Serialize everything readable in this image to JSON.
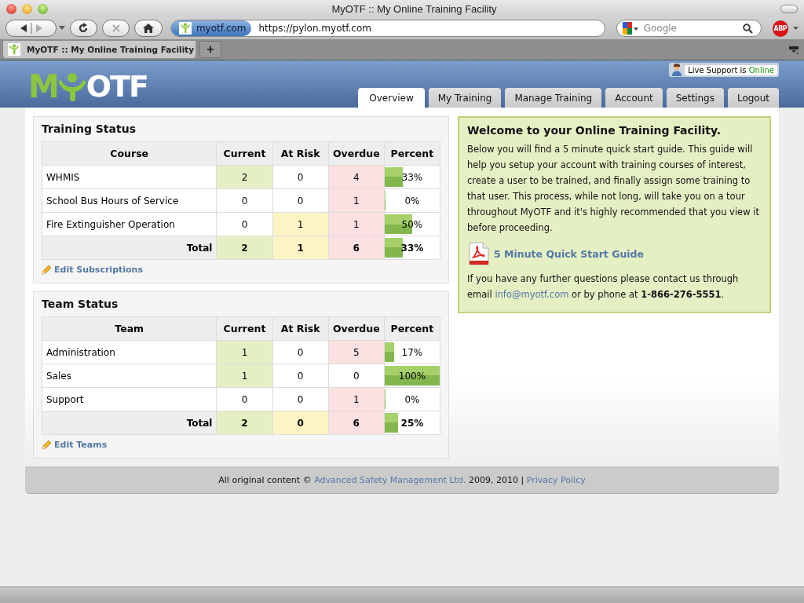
{
  "window": {
    "title": "MyOTF :: My Online Training Facility"
  },
  "toolbar": {
    "site": "myotf.com",
    "url": "https://pylon.myotf.com",
    "search_placeholder": "Google",
    "adblock": "ABP"
  },
  "tabs": [
    {
      "label": "MyOTF :: My Online Training Facility",
      "selected": true
    }
  ],
  "new_tab": "+",
  "header": {
    "logo_left": "M",
    "logo_right": "OTF",
    "live_support": {
      "text": "Live Support is",
      "status": "Online",
      "online": true
    },
    "nav": [
      {
        "label": "Overview",
        "selected": true
      },
      {
        "label": "My Training",
        "selected": false
      },
      {
        "label": "Manage Training",
        "selected": false
      },
      {
        "label": "Account",
        "selected": false
      },
      {
        "label": "Settings",
        "selected": false
      },
      {
        "label": "Logout",
        "selected": false
      }
    ]
  },
  "panels": [
    {
      "title": "Training Status",
      "columns": [
        "Course",
        "Current",
        "At Risk",
        "Overdue",
        "Percent"
      ],
      "rows": [
        {
          "kind": "item",
          "name": "WHMIS",
          "current": {
            "value": "2",
            "highlight": true
          },
          "at_risk": {
            "value": "0",
            "highlight": false
          },
          "overdue": {
            "value": "4",
            "highlight": true
          },
          "percent": "33%",
          "level": 0.33
        },
        {
          "kind": "item",
          "name": "School Bus Hours of Service",
          "current": {
            "value": "0",
            "highlight": false
          },
          "at_risk": {
            "value": "0",
            "highlight": false
          },
          "overdue": {
            "value": "1",
            "highlight": true
          },
          "percent": "0%",
          "level": 0
        },
        {
          "kind": "item",
          "name": "Fire Extinguisher Operation",
          "current": {
            "value": "0",
            "highlight": false
          },
          "at_risk": {
            "value": "1",
            "highlight": true
          },
          "overdue": {
            "value": "1",
            "highlight": true
          },
          "percent": "50%",
          "level": 0.5
        },
        {
          "kind": "total",
          "name": "Total",
          "current": {
            "value": "2",
            "highlight": true
          },
          "at_risk": {
            "value": "1",
            "highlight": true
          },
          "overdue": {
            "value": "6",
            "highlight": true
          },
          "percent": "33%",
          "level": 0.33
        }
      ],
      "edit_link": "Edit Subscriptions"
    },
    {
      "title": "Team Status",
      "columns": [
        "Team",
        "Current",
        "At Risk",
        "Overdue",
        "Percent"
      ],
      "rows": [
        {
          "kind": "item",
          "name": "Administration",
          "current": {
            "value": "1",
            "highlight": true
          },
          "at_risk": {
            "value": "0",
            "highlight": false
          },
          "overdue": {
            "value": "5",
            "highlight": true
          },
          "percent": "17%",
          "level": 0.17
        },
        {
          "kind": "item",
          "name": "Sales",
          "current": {
            "value": "1",
            "highlight": true
          },
          "at_risk": {
            "value": "0",
            "highlight": false
          },
          "overdue": {
            "value": "0",
            "highlight": false
          },
          "percent": "100%",
          "level": 1
        },
        {
          "kind": "item",
          "name": "Support",
          "current": {
            "value": "0",
            "highlight": false
          },
          "at_risk": {
            "value": "0",
            "highlight": false
          },
          "overdue": {
            "value": "1",
            "highlight": true
          },
          "percent": "0%",
          "level": 0
        },
        {
          "kind": "total",
          "name": "Total",
          "current": {
            "value": "2",
            "highlight": true
          },
          "at_risk": {
            "value": "0",
            "highlight": true
          },
          "overdue": {
            "value": "6",
            "highlight": true
          },
          "percent": "25%",
          "level": 0.25
        }
      ],
      "edit_link": "Edit Teams"
    }
  ],
  "welcome": {
    "title": "Welcome to your Online Training Facility.",
    "intro": "Below you will find a 5 minute quick start guide. This guide will help you setup your account with training courses of interest, create a user to be trained, and finally assign some training to that user. This process, while not long, will take you on a tour throughout MyOTF and it's highly recommended that you view it before proceeding.",
    "guide_link": "5 Minute Quick Start Guide",
    "contact_before": "If you have any further questions please contact us through email",
    "contact_email": "info@myotf.com",
    "contact_after": "or by phone at **1-866-276-5551**."
  },
  "footer": {
    "before": "All original content ©",
    "company_link": "Advanced Safety Management Ltd.",
    "years": "2009, 2010 |",
    "privacy_link": "Privacy Policy"
  }
}
